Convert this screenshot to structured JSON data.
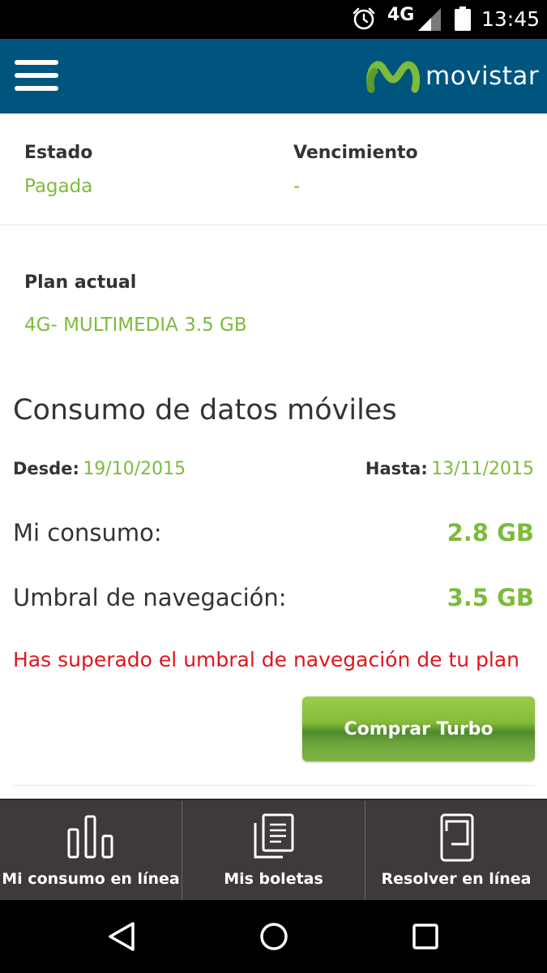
{
  "status_bar": {
    "network": "4G",
    "time": "13:45"
  },
  "header": {
    "brand": "movistar",
    "brand_color": "#00557e",
    "logo_color": "#7dbb3b"
  },
  "account": {
    "estado_label": "Estado",
    "estado_value": "Pagada",
    "vencimiento_label": "Vencimiento",
    "vencimiento_value": "-",
    "plan_label": "Plan actual",
    "plan_value": "4G- MULTIMEDIA 3.5 GB"
  },
  "consumo": {
    "title": "Consumo de datos móviles",
    "desde_label": "Desde:",
    "desde_value": "19/10/2015",
    "hasta_label": "Hasta:",
    "hasta_value": "13/11/2015",
    "mi_consumo_label": "Mi consumo:",
    "mi_consumo_value": "2.8 GB",
    "umbral_label": "Umbral de navegación:",
    "umbral_value": "3.5 GB",
    "warning": "Has superado el umbral de navegación de tu plan",
    "turbo_button": "Comprar Turbo"
  },
  "tabs": [
    {
      "label": "Mi consumo en línea",
      "icon": "bar-chart-icon"
    },
    {
      "label": "Mis boletas",
      "icon": "documents-icon"
    },
    {
      "label": "Resolver en línea",
      "icon": "device-icon"
    }
  ],
  "colors": {
    "accent_green": "#7dbb3b",
    "warning_red": "#e3141b",
    "tabbar_bg": "#3d3a39"
  }
}
